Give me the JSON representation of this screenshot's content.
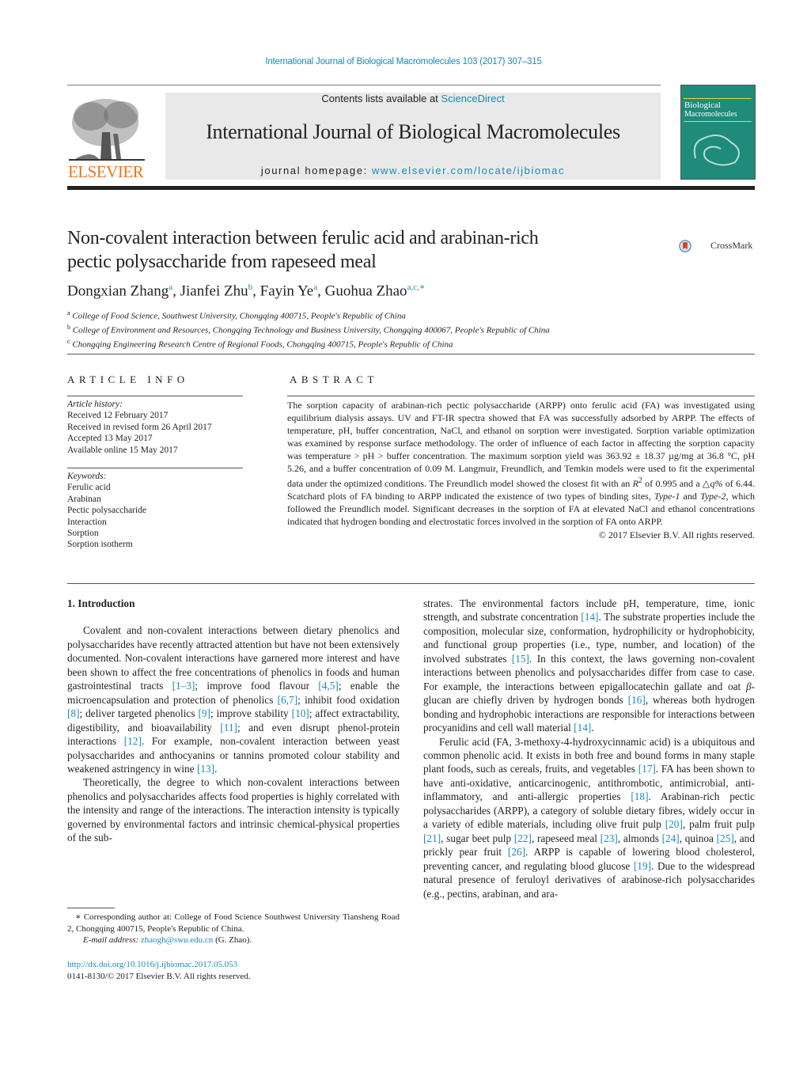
{
  "running_head": "International Journal of Biological Macromolecules 103 (2017) 307–315",
  "masthead": {
    "publisher": "ELSEVIER",
    "contents_prefix": "Contents lists available at ",
    "contents_link": "ScienceDirect",
    "journal_name": "International Journal of Biological Macromolecules",
    "homepage_prefix": "journal homepage: ",
    "homepage_link": "www.elsevier.com/locate/ijbiomac",
    "cover_title_1": "Biological",
    "cover_title_2": "Macromolecules",
    "cover_color": "#1f8b7a",
    "publisher_color": "#e87722",
    "link_color": "#1a8ab5"
  },
  "article": {
    "title_line1": "Non-covalent interaction between ferulic acid and arabinan-rich",
    "title_line2": "pectic polysaccharide from rapeseed meal",
    "crossmark_label": "CrossMark",
    "authors": [
      {
        "name": "Dongxian Zhang",
        "sup": "a"
      },
      {
        "name": "Jianfei Zhu",
        "sup": "b"
      },
      {
        "name": "Fayin Ye",
        "sup": "a"
      },
      {
        "name": "Guohua Zhao",
        "sup": "a,c,∗"
      }
    ],
    "affiliations": [
      {
        "mark": "a",
        "text": "College of Food Science, Southwest University, Chongqing 400715, People's Republic of China"
      },
      {
        "mark": "b",
        "text": "College of Environment and Resources, Chongqing Technology and Business University, Chongqing 400067, People's Republic of China"
      },
      {
        "mark": "c",
        "text": "Chongqing Engineering Research Centre of Regional Foods, Chongqing 400715, People's Republic of China"
      }
    ]
  },
  "article_info": {
    "heading": "ARTICLE INFO",
    "history_label": "Article history:",
    "history": [
      "Received 12 February 2017",
      "Received in revised form 26 April 2017",
      "Accepted 13 May 2017",
      "Available online 15 May 2017"
    ],
    "keywords_label": "Keywords:",
    "keywords": [
      "Ferulic acid",
      "Arabinan",
      "Pectic polysaccharide",
      "Interaction",
      "Sorption",
      "Sorption isotherm"
    ]
  },
  "abstract": {
    "heading": "ABSTRACT",
    "p1": "The sorption capacity of arabinan-rich pectic polysaccharide (ARPP) onto ferulic acid (FA) was investigated using equilibrium dialysis assays. UV and FT-IR spectra showed that FA was successfully adsorbed by ARPP. The effects of temperature, pH, buffer concentration, NaCl, and ethanol on sorption were investigated. Sorption variable optimization was examined by response surface methodology. The order of influence of each factor in affecting the sorption capacity was temperature > pH > buffer concentration. The maximum sorption yield was 363.92 ± 18.37 µg/mg at 36.8 °C, pH 5.26, and a buffer concentration of 0.09 M. Langmuir, Freundlich, and Temkin models were used to fit the experimental data under the optimized conditions. The Freundlich model showed the closest fit with an ",
    "r2": "R",
    "r2_sup": "2",
    "p2": " of 0.995 and a △",
    "q": "q%",
    "p3": " of 6.44. Scatchard plots of FA binding to ARPP indicated the existence of two types of binding sites, ",
    "type1": "Type-1",
    "p4": " and ",
    "type2": "Type-2",
    "p5": ", which followed the Freundlich model. Significant decreases in the sorption of FA at elevated NaCl and ethanol concentrations indicated that hydrogen bonding and electrostatic forces involved in the sorption of FA onto ARPP.",
    "copyright": "© 2017 Elsevier B.V. All rights reserved."
  },
  "intro": {
    "heading": "1.  Introduction",
    "left_p1": [
      {
        "t": "Covalent and non-covalent interactions between dietary phenolics and polysaccharides have recently attracted attention but have not been extensively documented. Non-covalent interactions have garnered more interest and have been shown to affect the free concentrations of phenolics in foods and human gastrointestinal tracts "
      },
      {
        "c": "[1–3]"
      },
      {
        "t": "; improve food flavour "
      },
      {
        "c": "[4,5]"
      },
      {
        "t": "; enable the microencapsulation and protection of phenolics "
      },
      {
        "c": "[6,7]"
      },
      {
        "t": "; inhibit food oxidation "
      },
      {
        "c": "[8]"
      },
      {
        "t": "; deliver targeted phenolics "
      },
      {
        "c": "[9]"
      },
      {
        "t": "; improve stability "
      },
      {
        "c": "[10]"
      },
      {
        "t": "; affect extractability, digestibility, and bioavailability "
      },
      {
        "c": "[11]"
      },
      {
        "t": "; and even disrupt phenol-protein interactions "
      },
      {
        "c": "[12]"
      },
      {
        "t": ". For example, non-covalent interaction between yeast polysaccharides and anthocyanins or tannins promoted colour stability and weakened astringency in wine "
      },
      {
        "c": "[13]"
      },
      {
        "t": "."
      }
    ],
    "left_p2": "Theoretically, the degree to which non-covalent interactions between phenolics and polysaccharides affects food properties is highly correlated with the intensity and range of the interactions. The interaction intensity is typically governed by environmental factors and intrinsic chemical-physical properties of the sub-",
    "right_p1": [
      {
        "t": "strates. The environmental factors include pH, temperature, time, ionic strength, and substrate concentration "
      },
      {
        "c": "[14]"
      },
      {
        "t": ". The substrate properties include the composition, molecular size, conformation, hydrophilicity or hydrophobicity, and functional group properties (i.e., type, number, and location) of the involved substrates "
      },
      {
        "c": "[15]"
      },
      {
        "t": ". In this context, the laws governing non-covalent interactions between phenolics and polysaccharides differ from case to case. For example, the interactions between epigallocatechin gallate and oat "
      },
      {
        "i": "β"
      },
      {
        "t": "-glucan are chiefly driven by hydrogen bonds "
      },
      {
        "c": "[16]"
      },
      {
        "t": ", whereas both hydrogen bonding and hydrophobic interactions are responsible for interactions between procyanidins and cell wall material "
      },
      {
        "c": "[14]"
      },
      {
        "t": "."
      }
    ],
    "right_p2": [
      {
        "t": "Ferulic acid (FA, 3-methoxy-4-hydroxycinnamic acid) is a ubiquitous and common phenolic acid. It exists in both free and bound forms in many staple plant foods, such as cereals, fruits, and vegetables "
      },
      {
        "c": "[17]"
      },
      {
        "t": ". FA has been shown to have anti-oxidative, anticarcinogenic, antithrombotic, antimicrobial, anti-inflammatory, and anti-allergic properties "
      },
      {
        "c": "[18]"
      },
      {
        "t": ". Arabinan-rich pectic polysaccharides (ARPP), a category of soluble dietary fibres, widely occur in a variety of edible materials, including olive fruit pulp "
      },
      {
        "c": "[20]"
      },
      {
        "t": ", palm fruit pulp "
      },
      {
        "c": "[21]"
      },
      {
        "t": ", sugar beet pulp "
      },
      {
        "c": "[22]"
      },
      {
        "t": ", rapeseed meal "
      },
      {
        "c": "[23]"
      },
      {
        "t": ", almonds "
      },
      {
        "c": "[24]"
      },
      {
        "t": ", quinoa "
      },
      {
        "c": "[25]"
      },
      {
        "t": ", and prickly pear fruit "
      },
      {
        "c": "[26]"
      },
      {
        "t": ". ARPP is capable of lowering blood cholesterol, preventing cancer, and regulating blood glucose "
      },
      {
        "c": "[19]"
      },
      {
        "t": ". Due to the widespread natural presence of feruloyl derivatives of arabinose-rich polysaccharides (e.g., pectins, arabinan, and ara-"
      }
    ]
  },
  "footnote": {
    "corresponding": "∗  Corresponding author at: College of Food Science Southwest University Tiansheng Road 2, Chongqing 400715, People's Republic of China.",
    "email_label": "E-mail address: ",
    "email": "zhaogh@swu.edu.cn",
    "email_suffix": " (G. Zhao)."
  },
  "doi": {
    "url": "http://dx.doi.org/10.1016/j.ijbiomac.2017.05.053",
    "issn": "0141-8130/© 2017 Elsevier B.V. All rights reserved."
  }
}
